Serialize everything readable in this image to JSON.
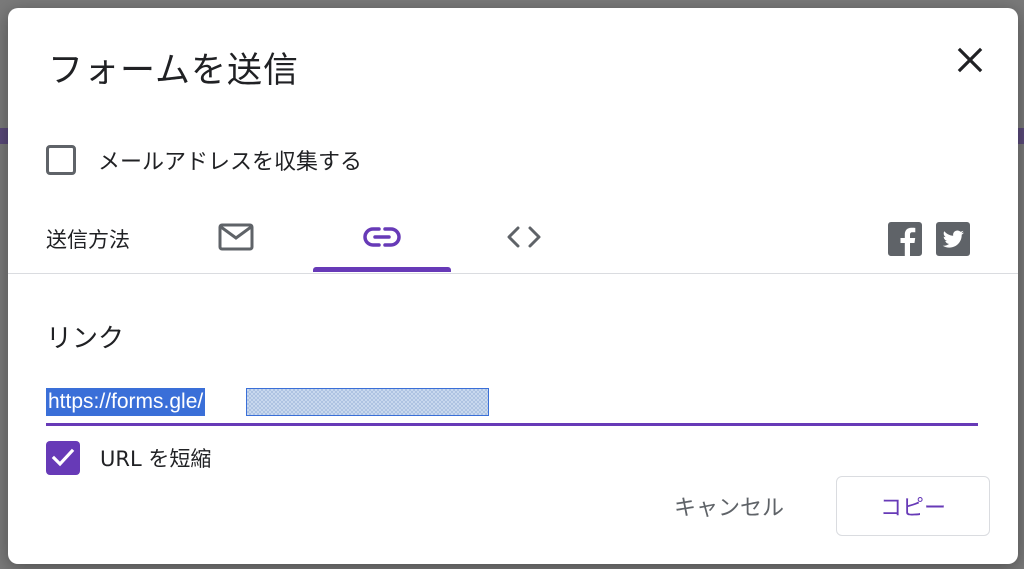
{
  "dialog": {
    "title": "フォームを送信",
    "close_icon": "close-icon"
  },
  "collect_emails": {
    "label": "メールアドレスを収集する",
    "checked": false
  },
  "send_via": {
    "label": "送信方法",
    "tabs": [
      {
        "icon": "email-icon",
        "selected": false
      },
      {
        "icon": "link-icon",
        "selected": true
      },
      {
        "icon": "embed-code-icon",
        "selected": false
      }
    ],
    "social": [
      {
        "icon": "facebook-icon"
      },
      {
        "icon": "twitter-icon"
      }
    ]
  },
  "link_section": {
    "title": "リンク",
    "url": "https://forms.gle/",
    "shorten_label": "URL を短縮",
    "shorten_checked": true
  },
  "actions": {
    "cancel_label": "キャンセル",
    "copy_label": "コピー"
  },
  "colors": {
    "accent": "#673ab7",
    "selection": "#3a6fd8",
    "icon": "#5f6368"
  }
}
